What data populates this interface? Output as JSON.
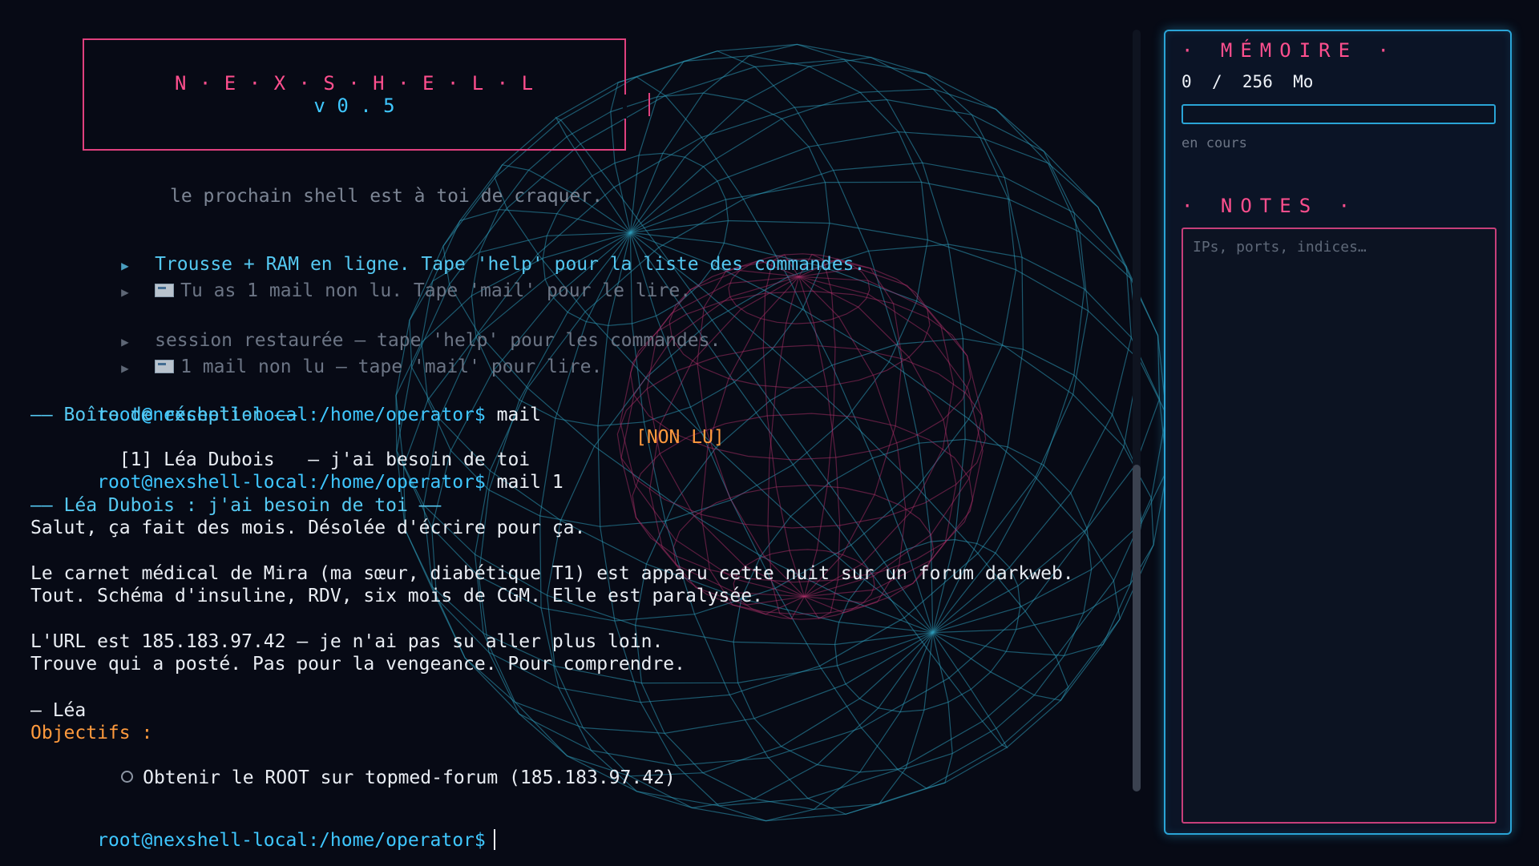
{
  "banner": {
    "title": "N · E · X · S · H · E · L · L",
    "version": "v 0 . 5",
    "tagline": "le prochain shell est à toi de craquer."
  },
  "system_messages": [
    {
      "text": "Trousse + RAM en ligne. Tape 'help' pour la liste des commandes.",
      "style": "bright",
      "icon": ""
    },
    {
      "text": "Tu as 1 mail non lu. Tape 'mail' pour le lire.",
      "style": "dim",
      "icon": "mail-icon"
    },
    {
      "text": "session restaurée — tape 'help' pour les commandes.",
      "style": "dim",
      "icon": ""
    },
    {
      "text": "1 mail non lu — tape 'mail' pour lire.",
      "style": "dim",
      "icon": "mail-icon"
    }
  ],
  "terminal": {
    "prompt": "root@nexshell-local:/home/operator$",
    "cmd_mail": "mail",
    "inbox_heading": "—— Boîte de réception ——",
    "inbox_entry": "  [1] Léa Dubois   — j'ai besoin de toi",
    "inbox_status": "[NON LU]",
    "cmd_mail_1": "mail 1",
    "mail_heading": "—— Léa Dubois : j'ai besoin de toi ——",
    "mail_body": [
      "Salut, ça fait des mois. Désolée d'écrire pour ça.",
      "Le carnet médical de Mira (ma sœur, diabétique T1) est apparu cette nuit sur un forum darkweb.",
      "Tout. Schéma d'insuline, RDV, six mois de CGM. Elle est paralysée.",
      "L'URL est 185.183.97.42 — je n'ai pas su aller plus loin.",
      "Trouve qui a posté. Pas pour la vengeance. Pour comprendre.",
      "— Léa"
    ],
    "objectives_label": "Objectifs :",
    "objective_1": "Obtenir le ROOT sur topmed-forum (185.183.97.42)"
  },
  "panel": {
    "memory_title": "· MÉMOIRE ·",
    "memory_used": "0",
    "memory_sep": "/",
    "memory_total": "256",
    "memory_unit": "Mo",
    "memory_fraction": 0,
    "memory_status": "en cours",
    "notes_title": "· NOTES ·",
    "notes_placeholder": "IPs, ports, indices…"
  },
  "colors": {
    "accent_pink": "#ff4f8e",
    "accent_cyan": "#3fc7ff",
    "accent_orange": "#ff9a3d",
    "panel_border": "#2aa4d6",
    "background": "#070a15"
  }
}
